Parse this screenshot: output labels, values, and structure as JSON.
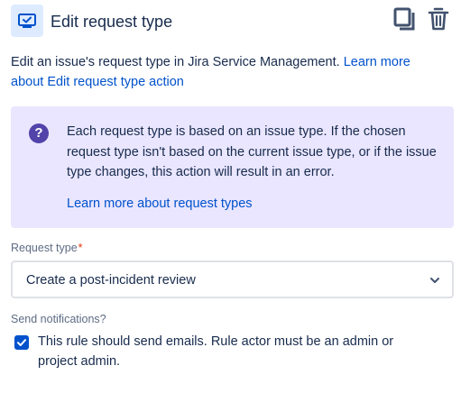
{
  "header": {
    "title": "Edit request type",
    "icon": "request-type-icon",
    "actions": [
      {
        "icon": "copy-icon"
      },
      {
        "icon": "trash-icon"
      }
    ]
  },
  "description": {
    "text": "Edit an issue's request type in Jira Service Management. ",
    "link": "Learn more about Edit request type action"
  },
  "info": {
    "icon_glyph": "?",
    "text": "Each request type is based on an issue type. If the chosen request type isn't based on the current issue type, or if the issue type changes, this action will result in an error.",
    "link": "Learn more about request types"
  },
  "request_type": {
    "label": "Request type",
    "required_mark": "*",
    "value": "Create a post-incident review"
  },
  "notifications": {
    "label": "Send notifications?",
    "checked": true,
    "checkbox_label": "This rule should send emails. Rule actor must be an admin or project admin."
  },
  "colors": {
    "link": "#0052cc",
    "info_bg": "#eae6ff",
    "info_icon": "#5243aa",
    "checkbox": "#0052cc",
    "required": "#de350b"
  }
}
